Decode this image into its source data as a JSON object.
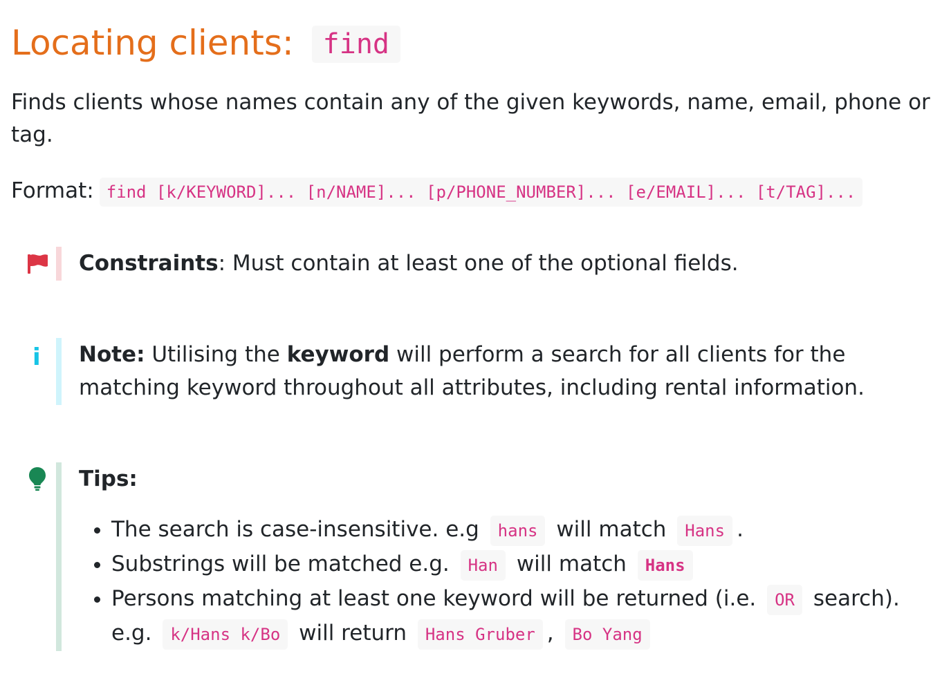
{
  "heading": {
    "text": "Locating clients:",
    "command": "find"
  },
  "description": "Finds clients whose names contain any of the given keywords, name, email, phone or tag.",
  "format": {
    "label": "Format:",
    "code": "find [k/KEYWORD]... [n/NAME]... [p/PHONE_NUMBER]... [e/EMAIL]... [t/TAG]..."
  },
  "constraint": {
    "icon": "flag-icon",
    "color": "#dc3545",
    "label": "Constraints",
    "text": ": Must contain at least one of the optional fields."
  },
  "note": {
    "icon": "info-icon",
    "color": "#17c4e6",
    "label": "Note:",
    "text_before": " Utilising the ",
    "keyword": "keyword",
    "text_after": " will perform a search for all clients for the matching keyword throughout all attributes, including rental information."
  },
  "tips": {
    "icon": "lightbulb-icon",
    "color": "#198754",
    "label": "Tips:",
    "items": [
      {
        "t1": "The search is case-insensitive. e.g",
        "c1": "hans",
        "t2": "will match",
        "c2": "Hans",
        "t3": "."
      },
      {
        "t1": "Substrings will be matched e.g.",
        "c1": "Han",
        "t2": "will match",
        "c2": "Hans"
      },
      {
        "t1": "Persons matching at least one keyword will be returned (i.e.",
        "c1": "OR",
        "t2": "search). e.g.",
        "c2": "k/Hans k/Bo",
        "t3": "will return",
        "c3": "Hans Gruber",
        "t4": ",",
        "c4": "Bo Yang"
      }
    ]
  }
}
